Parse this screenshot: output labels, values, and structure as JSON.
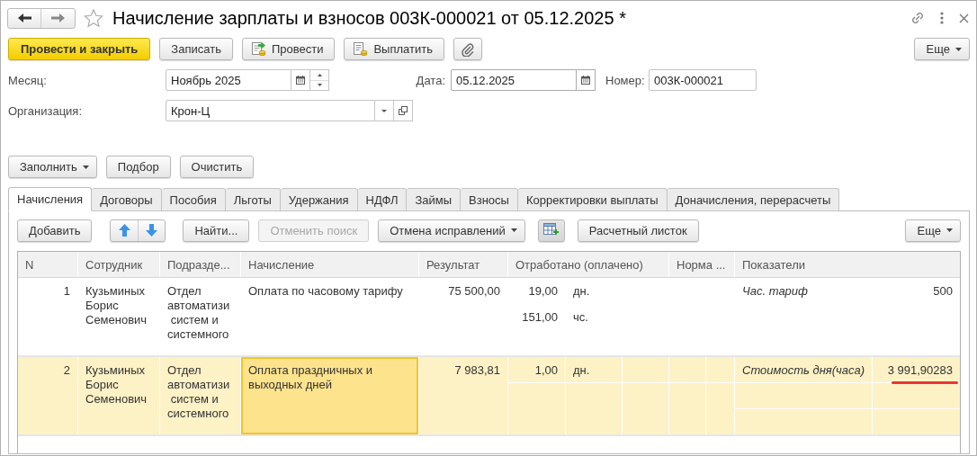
{
  "window": {
    "title": "Начисление зарплаты и взносов 003К-000021 от 05.12.2025 *"
  },
  "toolbar": {
    "buttons": [
      {
        "kind": "primary",
        "label": "Провести и закрыть"
      },
      {
        "kind": "plain",
        "label": "Записать"
      },
      {
        "kind": "post",
        "label": "Провести"
      },
      {
        "kind": "pay",
        "label": "Выплатить"
      },
      {
        "kind": "attach"
      }
    ],
    "more": "Еще"
  },
  "fields": {
    "month": {
      "label": "Месяц:",
      "value": "Ноябрь 2025"
    },
    "date": {
      "label": "Дата:",
      "value": "05.12.2025"
    },
    "number": {
      "label": "Номер:",
      "value": "003К-000021"
    },
    "organization": {
      "label": "Организация:",
      "value": "Крон-Ц"
    }
  },
  "fill_buttons": [
    {
      "label": "Заполнить",
      "kind": "dropdown"
    },
    {
      "label": "Подбор",
      "kind": "button"
    },
    {
      "label": "Очистить",
      "kind": "button"
    }
  ],
  "tabs": [
    {
      "label": "Начисления",
      "selected": true
    },
    {
      "label": "Договоры",
      "selected": false
    },
    {
      "label": "Пособия",
      "selected": false
    },
    {
      "label": "Льготы",
      "selected": false
    },
    {
      "label": "Удержания",
      "selected": false
    },
    {
      "label": "НДФЛ",
      "selected": false
    },
    {
      "label": "Займы",
      "selected": false
    },
    {
      "label": "Взносы",
      "selected": false
    },
    {
      "label": "Корректировки выплаты",
      "selected": false
    },
    {
      "label": "Доначисления, перерасчеты",
      "selected": false
    }
  ],
  "table_toolbar": {
    "buttons": [
      {
        "kind": "text",
        "label": "Добавить",
        "disabled": false
      },
      {
        "kind": "arrows"
      },
      {
        "kind": "text",
        "label": "Найти...",
        "disabled": false
      },
      {
        "kind": "text",
        "label": "Отменить поиск",
        "disabled": true
      },
      {
        "kind": "dropdown",
        "label": "Отмена исправлений",
        "disabled": false
      },
      {
        "kind": "table_add"
      },
      {
        "kind": "text",
        "label": "Расчетный листок",
        "disabled": false
      }
    ],
    "more": "Еще"
  },
  "table": {
    "columns": [
      "N",
      "Сотрудник",
      "Подразде...",
      "Начисление",
      "Результат",
      "Отработано (оплачено)",
      "Норма ...",
      "Показатели"
    ],
    "rows": [
      {
        "n": "1",
        "employee": "Кузьминых\nБорис\nСеменович",
        "department": "Отдел\nавтоматизи\n систем и\nсистемного",
        "accrual": "Оплата по часовому тарифу",
        "result": "75 500,00",
        "worked": [
          {
            "value": "19,00",
            "unit": "дн."
          },
          {
            "value": "151,00",
            "unit": "чс."
          }
        ],
        "indicators": [
          {
            "name": "Час. тариф",
            "value": "500",
            "marked": false
          }
        ],
        "selected": false,
        "accrual_focused": false
      },
      {
        "n": "2",
        "employee": "Кузьминых\nБорис\nСеменович",
        "department": "Отдел\nавтоматизи\n систем и\nсистемного",
        "accrual": "Оплата праздничных и выходных дней",
        "result": "7 983,81",
        "worked": [
          {
            "value": "1,00",
            "unit": "дн."
          }
        ],
        "indicators": [
          {
            "name": "Стоимость дня(часа)",
            "value": "3 991,90283",
            "marked": true
          }
        ],
        "selected": true,
        "accrual_focused": true
      }
    ]
  }
}
